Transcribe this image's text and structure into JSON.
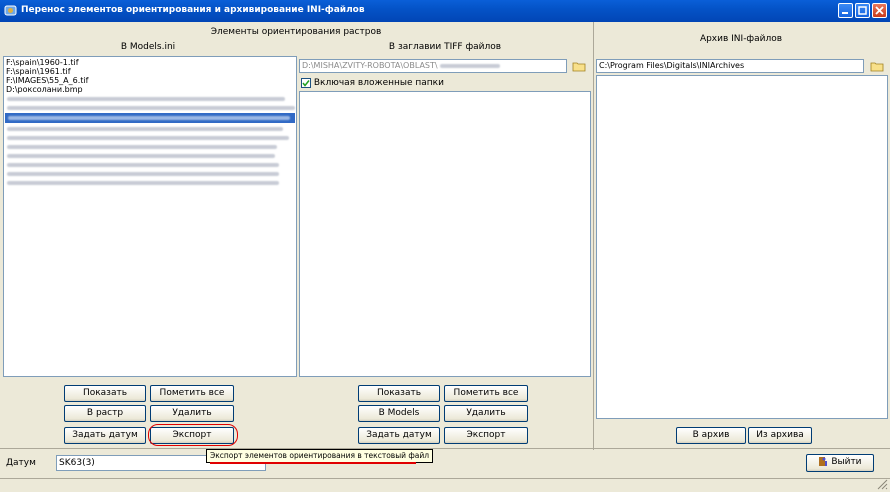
{
  "window": {
    "title": "Перенос элементов ориентирования и архивирование INI-файлов",
    "minimize_label": "",
    "maximize_label": "",
    "close_label": ""
  },
  "orientation": {
    "header": "Элементы ориентирования растров",
    "models_ini_header": "В Models.ini",
    "tiff_header": "В заглавии TIFF файлов",
    "models_list": [
      "F:\\spain\\1960-1.tif",
      "F:\\spain\\1961.tif",
      "F:\\IMAGES\\55_A_6.tif",
      "D:\\рокcолани.bmp"
    ],
    "tiff_path": "D:\\MISHA\\ZVITY-ROBOTA\\OBLAST\\",
    "include_subfolders_label": "Включая вложенные папки",
    "include_subfolders_checked": true
  },
  "archive": {
    "header": "Архив INI-файлов",
    "path": "C:\\Program Files\\Digitals\\INIArchives",
    "to_archive_label": "В архив",
    "from_archive_label": "Из архива"
  },
  "left_buttons": {
    "show": "Показать",
    "mark_all": "Пометить все",
    "to_raster": "В растр",
    "delete": "Удалить",
    "set_datum": "Задать датум",
    "export": "Экспорт"
  },
  "mid_buttons": {
    "show": "Показать",
    "mark_all": "Пометить все",
    "to_models": "В Models",
    "delete": "Удалить",
    "set_datum": "Задать датум",
    "export": "Экспорт"
  },
  "datum": {
    "label": "Датум",
    "value": "SK63(3)"
  },
  "tooltip": "Экспорт элементов ориентирования в текстовый файл",
  "exit_label": "Выйти",
  "colors": {
    "title_bar": "#0453c7",
    "selection": "#316ac5",
    "annotation": "#e00000"
  }
}
